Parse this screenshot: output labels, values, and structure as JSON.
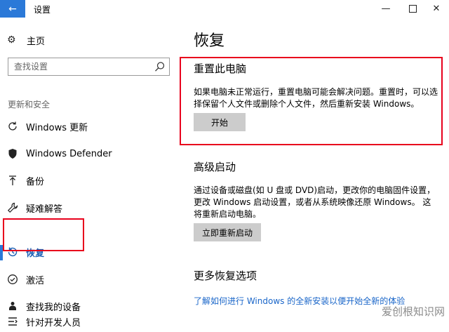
{
  "window": {
    "title": "设置",
    "back_icon": "arrow-left-icon",
    "accent_color": "#2b79d8"
  },
  "sidebar": {
    "home_label": "主页",
    "search_placeholder": "查找设置",
    "section_title": "更新和安全",
    "items": [
      {
        "label": "Windows 更新",
        "icon": "refresh-icon"
      },
      {
        "label": "Windows Defender",
        "icon": "shield-icon"
      },
      {
        "label": "备份",
        "icon": "upload-arrow-icon"
      },
      {
        "label": "疑难解答",
        "icon": "wrench-icon"
      },
      {
        "label": "恢复",
        "icon": "history-icon",
        "active": true
      },
      {
        "label": "激活",
        "icon": "check-circle-icon"
      },
      {
        "label": "查找我的设备",
        "icon": "person-pin-icon"
      },
      {
        "label": "针对开发人员",
        "icon": "developer-icon"
      }
    ]
  },
  "main": {
    "title": "恢复",
    "reset": {
      "heading": "重置此电脑",
      "description": "如果电脑未正常运行，重置电脑可能会解决问题。重置时，可以选择保留个人文件或删除个人文件，然后重新安装 Windows。",
      "button": "开始"
    },
    "advanced": {
      "heading": "高级启动",
      "description": "通过设备或磁盘(如 U 盘或 DVD)启动，更改你的电脑固件设置，更改 Windows 启动设置，或者从系统映像还原 Windows。 这将重新启动电脑。",
      "button": "立即重新启动"
    },
    "more": {
      "heading": "更多恢复选项",
      "link": "了解如何进行 Windows 的全新安装以便开始全新的体验"
    }
  },
  "watermark": "爱创根知识网",
  "highlight_color": "#e8001c"
}
